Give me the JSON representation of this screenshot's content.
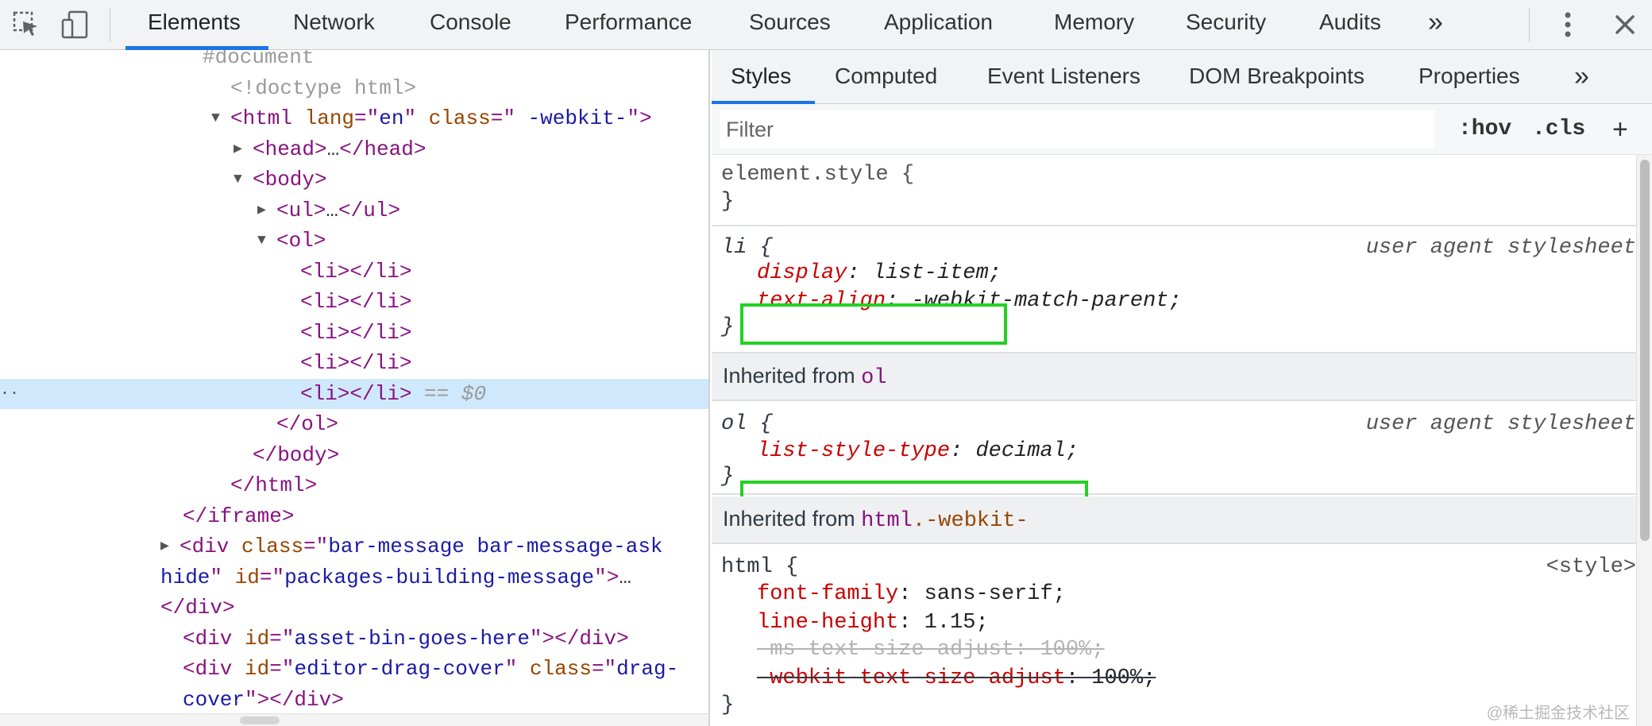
{
  "toolbar": {
    "tabs": [
      "Elements",
      "Network",
      "Console",
      "Performance",
      "Sources",
      "Application",
      "Memory",
      "Security",
      "Audits"
    ],
    "overflow": "»",
    "active_tab": "Elements"
  },
  "elements": {
    "lines": [
      {
        "indent": 255,
        "parts": [
          [
            "gray",
            "#document"
          ]
        ]
      },
      {
        "indent": 290,
        "parts": [
          [
            "gray",
            "<!doctype html>"
          ]
        ]
      },
      {
        "indent": 290,
        "tri": "▼",
        "parts": [
          [
            "tag",
            "<html"
          ],
          [
            "plain",
            " "
          ],
          [
            "attr",
            "lang"
          ],
          [
            "tag",
            "=\""
          ],
          [
            "val",
            "en"
          ],
          [
            "tag",
            "\""
          ],
          [
            "plain",
            " "
          ],
          [
            "attr",
            "class"
          ],
          [
            "tag",
            "=\""
          ],
          [
            "val",
            " -webkit-"
          ],
          [
            "tag",
            "\">"
          ]
        ]
      },
      {
        "indent": 318,
        "tri": "▶",
        "parts": [
          [
            "tag",
            "<head>"
          ],
          [
            "plain",
            "…"
          ],
          [
            "tag",
            "</head>"
          ]
        ]
      },
      {
        "indent": 318,
        "tri": "▼",
        "parts": [
          [
            "tag",
            "<body>"
          ]
        ]
      },
      {
        "indent": 348,
        "tri": "▶",
        "parts": [
          [
            "tag",
            "<ul>"
          ],
          [
            "plain",
            "…"
          ],
          [
            "tag",
            "</ul>"
          ]
        ]
      },
      {
        "indent": 348,
        "tri": "▼",
        "parts": [
          [
            "tag",
            "<ol>"
          ]
        ]
      },
      {
        "indent": 378,
        "parts": [
          [
            "tag",
            "<li></li>"
          ]
        ]
      },
      {
        "indent": 378,
        "parts": [
          [
            "tag",
            "<li></li>"
          ]
        ]
      },
      {
        "indent": 378,
        "parts": [
          [
            "tag",
            "<li></li>"
          ]
        ]
      },
      {
        "indent": 378,
        "parts": [
          [
            "tag",
            "<li></li>"
          ]
        ]
      },
      {
        "indent": 378,
        "selected": true,
        "parts": [
          [
            "tag",
            "<li></li>"
          ],
          [
            "gray",
            " == "
          ],
          [
            "gray-italic",
            "$0"
          ]
        ]
      },
      {
        "indent": 348,
        "parts": [
          [
            "tag",
            "</ol>"
          ]
        ]
      },
      {
        "indent": 318,
        "parts": [
          [
            "tag",
            "</body>"
          ]
        ]
      },
      {
        "indent": 290,
        "parts": [
          [
            "tag",
            "</html>"
          ]
        ]
      },
      {
        "indent": 230,
        "parts": [
          [
            "tag",
            "</iframe>"
          ]
        ]
      },
      {
        "indent": 226,
        "tri": "▶",
        "parts": [
          [
            "tag",
            "<div"
          ],
          [
            "plain",
            " "
          ],
          [
            "attr",
            "class"
          ],
          [
            "tag",
            "=\""
          ],
          [
            "val",
            "bar-message bar-message-ask"
          ]
        ]
      },
      {
        "indent": 202,
        "parts": [
          [
            "val",
            "hide"
          ],
          [
            "tag",
            "\""
          ],
          [
            "plain",
            " "
          ],
          [
            "attr",
            "id"
          ],
          [
            "tag",
            "=\""
          ],
          [
            "val",
            "packages-building-message"
          ],
          [
            "tag",
            "\">"
          ],
          [
            "plain",
            "…"
          ]
        ]
      },
      {
        "indent": 202,
        "parts": [
          [
            "tag",
            "</div>"
          ]
        ]
      },
      {
        "indent": 230,
        "parts": [
          [
            "tag",
            "<div"
          ],
          [
            "plain",
            " "
          ],
          [
            "attr",
            "id"
          ],
          [
            "tag",
            "=\""
          ],
          [
            "val",
            "asset-bin-goes-here"
          ],
          [
            "tag",
            "\"></div>"
          ]
        ]
      },
      {
        "indent": 230,
        "parts": [
          [
            "tag",
            "<div"
          ],
          [
            "plain",
            " "
          ],
          [
            "attr",
            "id"
          ],
          [
            "tag",
            "=\""
          ],
          [
            "val",
            "editor-drag-cover"
          ],
          [
            "tag",
            "\""
          ],
          [
            "plain",
            " "
          ],
          [
            "attr",
            "class"
          ],
          [
            "tag",
            "=\""
          ],
          [
            "val",
            "drag-"
          ]
        ]
      },
      {
        "indent": 230,
        "parts": [
          [
            "val",
            "cover"
          ],
          [
            "tag",
            "\"></div>"
          ]
        ]
      },
      {
        "indent": 202,
        "parts": [
          [
            "tag",
            "</div>"
          ]
        ]
      }
    ]
  },
  "styles": {
    "sub_tabs": [
      "Styles",
      "Computed",
      "Event Listeners",
      "DOM Breakpoints",
      "Properties"
    ],
    "overflow": "»",
    "active_sub_tab": "Styles",
    "filter_placeholder": "Filter",
    "hov_label": ":hov",
    "cls_label": ".cls",
    "add_label": "+",
    "element_style": {
      "selector": "element.style {",
      "close": "}"
    },
    "li_rule": {
      "selector": "li",
      "brace_open": " {",
      "source": "user agent stylesheet",
      "props": [
        {
          "name": "display",
          "value": "list-item"
        },
        {
          "name": "text-align",
          "value": "-webkit-match-parent"
        }
      ],
      "close": "}"
    },
    "inherited_ol": {
      "label": "Inherited from ",
      "selector": "ol"
    },
    "ol_rule": {
      "selector": "ol",
      "brace_open": " {",
      "source": "user agent stylesheet",
      "props": [
        {
          "name": "list-style-type",
          "value": "decimal"
        }
      ],
      "close": "}"
    },
    "inherited_html": {
      "label": "Inherited from ",
      "selector_tag": "html",
      "selector_class": ".-webkit-"
    },
    "html_rule": {
      "selector": "html",
      "brace_open": " {",
      "source": "<style>",
      "props": [
        {
          "name": "font-family",
          "value": "sans-serif"
        },
        {
          "name": "line-height",
          "value": "1.15"
        },
        {
          "name": "-ms-text-size-adjust",
          "value": "100%"
        },
        {
          "name": "-webkit-text-size-adjust",
          "value": "100%"
        }
      ],
      "close": "}"
    },
    "watermark": "@稀土掘金技术社区"
  }
}
